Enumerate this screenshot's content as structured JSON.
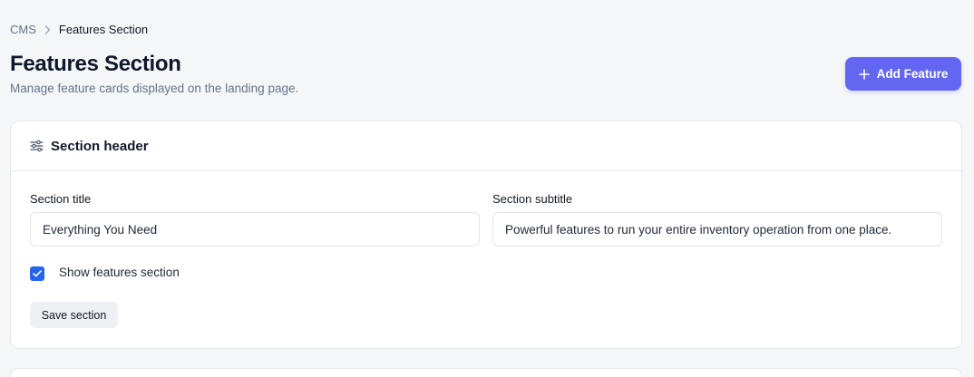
{
  "breadcrumb": {
    "root": "CMS",
    "current": "Features Section"
  },
  "header": {
    "title": "Features Section",
    "subtitle": "Manage feature cards displayed on the landing page.",
    "add_button_label": "Add Feature"
  },
  "section_card": {
    "title": "Section header",
    "title_label": "Section title",
    "title_value": "Everything You Need",
    "subtitle_label": "Section subtitle",
    "subtitle_value": "Powerful features to run your entire inventory operation from one place.",
    "show_label": "Show features section",
    "show_checked": true,
    "save_label": "Save section"
  },
  "icons": {
    "breadcrumb_separator": "chevron-right-icon",
    "add": "plus-icon",
    "section": "sliders-icon",
    "checkbox": "check-icon"
  },
  "colors": {
    "primary": "#6366f1",
    "checkbox": "#2563eb",
    "background": "#f5f6f8",
    "muted_text": "#64748b"
  }
}
